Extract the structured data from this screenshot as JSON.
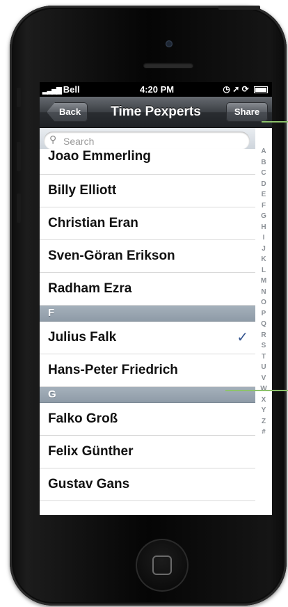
{
  "status_bar": {
    "carrier": "Bell",
    "time": "4:20 PM"
  },
  "nav": {
    "back_label": "Back",
    "title": "Time Pexperts",
    "share_label": "Share"
  },
  "search": {
    "placeholder": "Search"
  },
  "list": {
    "rows": [
      {
        "name": "Joao Emmerling"
      },
      {
        "name": "Billy Elliott"
      },
      {
        "name": "Christian Eran"
      },
      {
        "name": "Sven-Göran Erikson"
      },
      {
        "name": "Radham Ezra"
      }
    ],
    "section_f": "F",
    "rows_f": [
      {
        "name": "Julius Falk",
        "checked": true
      },
      {
        "name": "Hans-Peter Friedrich"
      }
    ],
    "section_g": "G",
    "rows_g": [
      {
        "name": "Falko Groß"
      },
      {
        "name": "Felix Günther"
      },
      {
        "name": "Gustav Gans"
      }
    ]
  },
  "index_letters": [
    "A",
    "B",
    "C",
    "D",
    "E",
    "F",
    "G",
    "H",
    "I",
    "J",
    "K",
    "L",
    "M",
    "N",
    "O",
    "P",
    "Q",
    "R",
    "S",
    "T",
    "U",
    "V",
    "W",
    "X",
    "Y",
    "Z",
    "#"
  ],
  "icons": {
    "search": "search-icon",
    "checkmark": "checkmark-icon",
    "location": "location-icon",
    "alarm": "alarm-icon",
    "battery": "battery-icon"
  },
  "colors": {
    "checkmark": "#34548f",
    "callout": "#8dc26b"
  }
}
